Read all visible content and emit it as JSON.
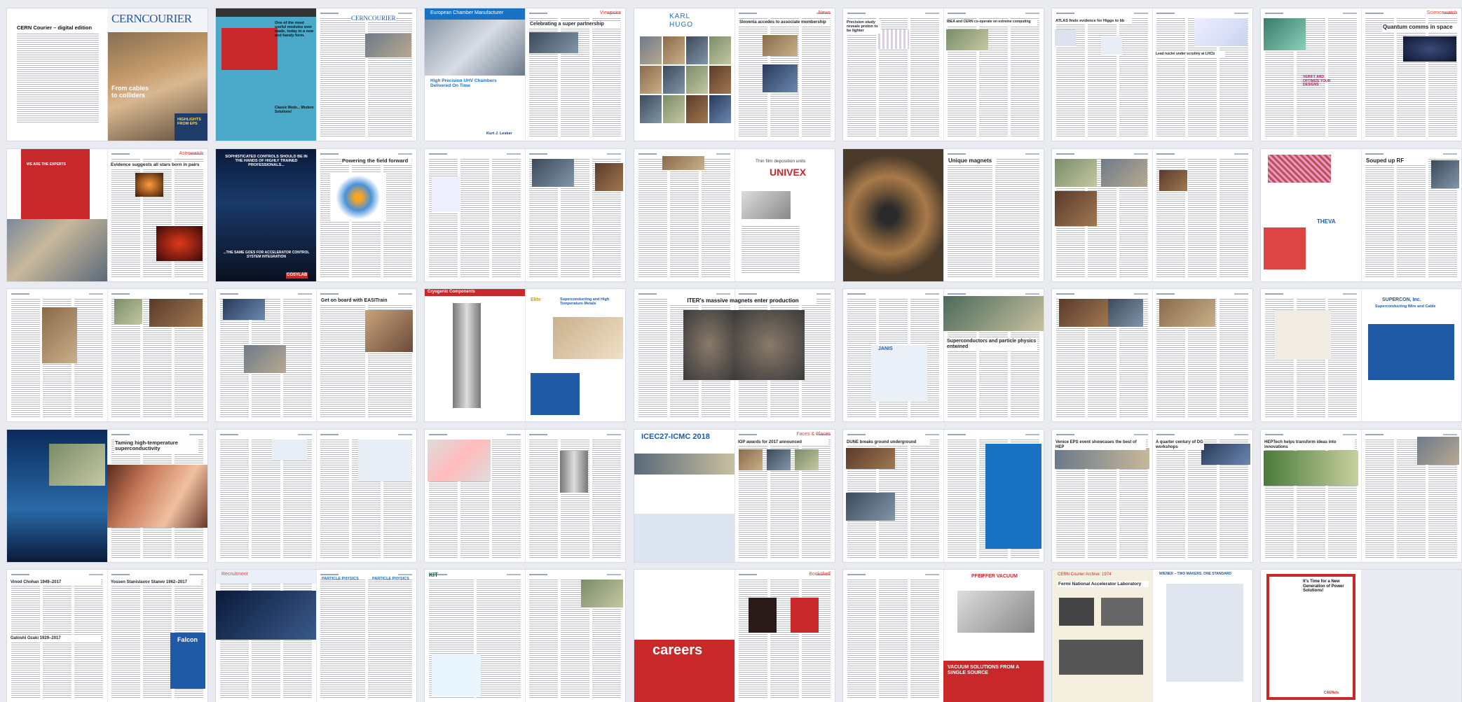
{
  "view": {
    "title": "CERN Courier – digital edition",
    "pages_label": "page thumbnails"
  },
  "colors": {
    "background": "#e9ebf1",
    "accent_red": "#e2443a",
    "courier_blue": "#1f5aa6",
    "ad_blue": "#1a72c4"
  },
  "headings": {
    "digital_edition": "CERN Courier – digital edition",
    "cover_masthead": "CERNCOURIER",
    "cover_headline": "From cables to colliders",
    "cover_side": "HIGHLIGHTS FROM EPS",
    "ad1": "One of the most useful modules ever made, today in a new and handy form.",
    "ad1_sub": "Classic Mode... Modern Solutions!",
    "ad2": "European Chamber Manufacturer",
    "ad2_sub": "High Precision UHV Chambers Delivered On Time",
    "ad2_brand": "Kurt J. Lesker",
    "viewpoint": "Viewpoint",
    "viewpoint_head": "Celebrating a super partnership",
    "news": "News",
    "news_head": "Slovenia accedes to associate membership",
    "karl": "KARL",
    "hugo": "HUGO",
    "precision": "Precision study reveals proton to be lighter",
    "isolde": "IBEA and CERN co-operate on extreme computing",
    "atlas": "ATLAS finds evidence for Higgs to bb",
    "lead": "Lead nuclei under scrutiny at LHCb",
    "sciencewatch": "Sciencewatch",
    "quantum": "Quantum comms in space",
    "verify": "VERIFY AND OPTIMIZE YOUR DESIGNS",
    "astrowatch": "Astrowatch",
    "evidence": "Evidence suggests all stars born in pairs",
    "we_are": "WE ARE THE EXPERTS",
    "sophisticated": "SOPHISTICATED CONTROLS SHOULD BE IN THE HANDS OF HIGHLY TRAINED PROFESSIONALS...",
    "same_goes": "...THE SAME GOES FOR ACCELERATOR CONTROL SYSTEM INTEGRATION",
    "cosylab": "COSYLAB",
    "powering": "Powering the field forward",
    "thin_film": "Thin film deposition units",
    "univex": "UNIVEX",
    "unique": "Unique magnets",
    "souped": "Souped up RF",
    "theva": "THEVA",
    "easitrain": "Get on board with EASITrain",
    "cryogenic": "Cryogenic Components",
    "elite": "Elite",
    "supercond_hts": "Superconducting and High Temperature Metals",
    "iter": "ITER's massive magnets enter production",
    "janis": "JANIS",
    "superconductors": "Superconductors and particle physics entwined",
    "supercon_inc": "SUPERCON, Inc.",
    "supercon_sub": "Superconducting Wire and Cable",
    "taming": "Taming high-temperature superconductivity",
    "icec": "ICEC27-ICMC 2018",
    "faces": "Faces & Places",
    "iop": "IOP awards for 2017 announced",
    "dune": "DUNE breaks ground underground",
    "venice": "Venice EPS event showcases the best of HEP",
    "quarter": "A quarter century of DG workshops",
    "hep_tech": "HEPTech helps transform ideas into innovations",
    "vinod": "Vinod Chohan 1949–2017",
    "yossen": "Yossen Stanislavov Stanev 1962–2017",
    "gatoshi": "Gatoshi Ozaki 1929–2017",
    "falcon": "Falcon",
    "recruitment": "Recruitment",
    "particle_physics": "PARTICLE PHYSICS",
    "kit": "KIT",
    "careers": "careers",
    "bookshelf": "Bookshelf",
    "pfeiffer": "PFEIFFER VACUUM",
    "vacuum_solutions": "VACUUM SOLUTIONS FROM A SINGLE SOURCE",
    "archive": "CERN Courier Archive: 1974",
    "fermi": "Fermi National Accelerator Laboratory",
    "wiener": "WIENER – TWO MAKERS, ONE STANDARD",
    "caen": "It's Time for a New Generation of Power Solutions!",
    "caen_brand": "CAENels"
  }
}
